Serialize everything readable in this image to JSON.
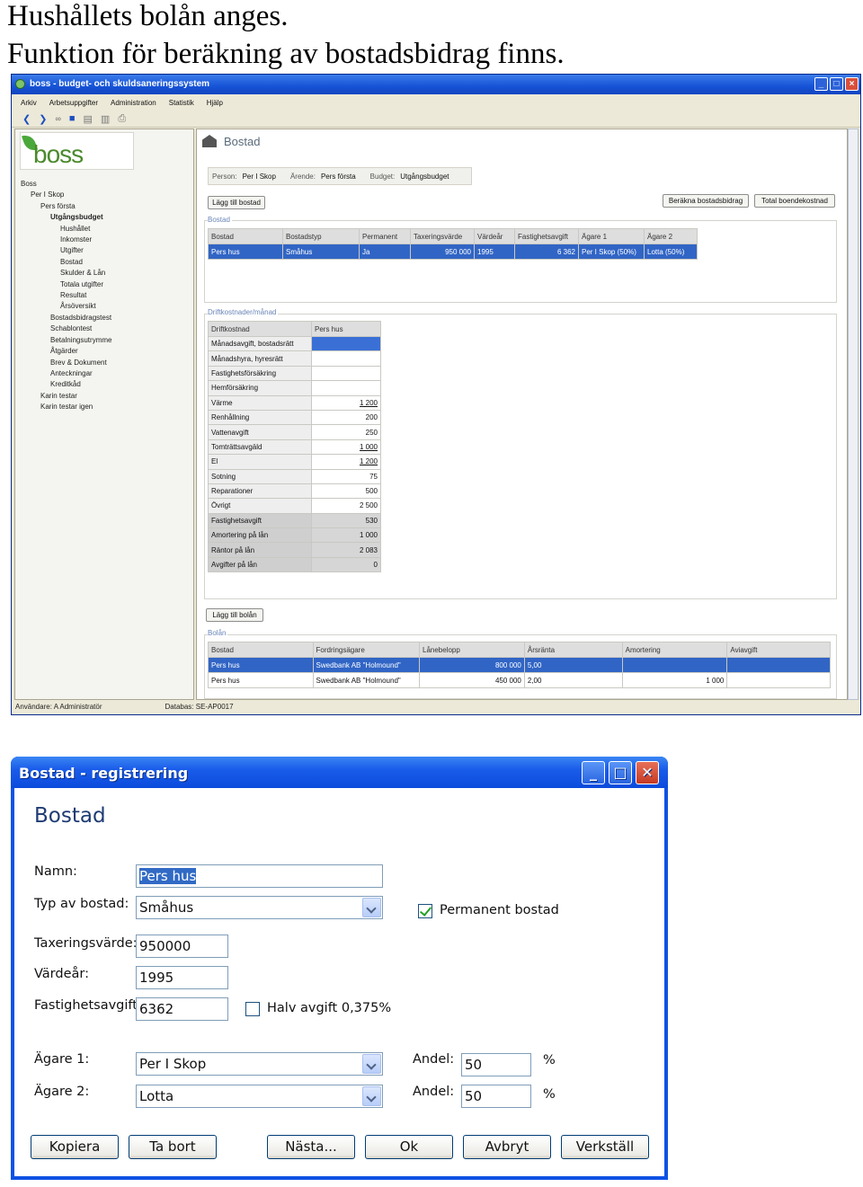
{
  "headings": [
    "Hushållets bolån anges.",
    "Funktion för beräkning av bostadsbidrag finns."
  ],
  "main_window": {
    "title": "boss - budget- och skuldsaneringssystem",
    "menu": [
      "Arkiv",
      "Arbetsuppgifter",
      "Administration",
      "Statistik",
      "Hjälp"
    ],
    "toolbar_icons": [
      "back-arrow-icon",
      "forward-arrow-icon",
      "glasses-icon",
      "save-icon",
      "print-icon",
      "copy-icon",
      "printer-icon"
    ],
    "logo_text": "boss",
    "tree": [
      {
        "label": "Boss",
        "level": 0,
        "bold": false
      },
      {
        "label": "Per I Skop",
        "level": 1,
        "bold": false
      },
      {
        "label": "Pers första",
        "level": 2,
        "bold": false
      },
      {
        "label": "Utgångsbudget",
        "level": 3,
        "bold": true
      },
      {
        "label": "Hushållet",
        "level": 4,
        "bold": false
      },
      {
        "label": "Inkomster",
        "level": 4,
        "bold": false
      },
      {
        "label": "Utgifter",
        "level": 4,
        "bold": false
      },
      {
        "label": "Bostad",
        "level": 4,
        "bold": false
      },
      {
        "label": "Skulder & Lån",
        "level": 4,
        "bold": false
      },
      {
        "label": "Totala utgifter",
        "level": 4,
        "bold": false
      },
      {
        "label": "Resultat",
        "level": 4,
        "bold": false
      },
      {
        "label": "Årsöversikt",
        "level": 4,
        "bold": false
      },
      {
        "label": "Bostadsbidragstest",
        "level": 3,
        "bold": false
      },
      {
        "label": "Schablontest",
        "level": 3,
        "bold": false
      },
      {
        "label": "Betalningsutrymme",
        "level": 3,
        "bold": false
      },
      {
        "label": "Åtgärder",
        "level": 3,
        "bold": false
      },
      {
        "label": "Brev & Dokument",
        "level": 3,
        "bold": false
      },
      {
        "label": "Anteckningar",
        "level": 3,
        "bold": false
      },
      {
        "label": "Kreditkåd",
        "level": 3,
        "bold": false
      },
      {
        "label": "Karin testar",
        "level": 2,
        "bold": false
      },
      {
        "label": "Karin testar igen",
        "level": 2,
        "bold": false
      }
    ],
    "panel_title": "Bostad",
    "info": {
      "person_label": "Person:",
      "person": "Per I Skop",
      "arende_label": "Ärende:",
      "arende": "Pers första",
      "budget_label": "Budget:",
      "budget": "Utgångsbudget"
    },
    "buttons": {
      "add_housing": "Lägg till bostad",
      "calc_bidrag": "Beräkna bostadsbidrag",
      "total_cost": "Total boendekostnad",
      "add_loan": "Lägg till bolån"
    },
    "housing": {
      "group_label": "Bostad",
      "columns": [
        "Bostad",
        "Bostadstyp",
        "Permanent",
        "Taxeringsvärde",
        "Värdeår",
        "Fastighetsavgift",
        "Ägare 1",
        "Ägare 2"
      ],
      "rows": [
        [
          "Pers hus",
          "Småhus",
          "Ja",
          "950 000",
          "1995",
          "6 362",
          "Per I Skop (50%)",
          "Lotta (50%)"
        ]
      ]
    },
    "costs": {
      "group_label": "Driftkostnader/månad",
      "col1": "Driftkostnad",
      "col2": "Pers hus",
      "rows": [
        {
          "label": "Månadsavgift, bostadsrätt",
          "value": "",
          "gray": false,
          "ul": false,
          "blue": true
        },
        {
          "label": "Månadshyra, hyresrätt",
          "value": "",
          "gray": false,
          "ul": false,
          "blue": false
        },
        {
          "label": "Fastighetsförsäkring",
          "value": "",
          "gray": false,
          "ul": false,
          "blue": false
        },
        {
          "label": "Hemförsäkring",
          "value": "",
          "gray": false,
          "ul": false,
          "blue": false
        },
        {
          "label": "Värme",
          "value": "1 200",
          "gray": false,
          "ul": true,
          "blue": false
        },
        {
          "label": "Renhållning",
          "value": "200",
          "gray": false,
          "ul": false,
          "blue": false
        },
        {
          "label": "Vattenavgift",
          "value": "250",
          "gray": false,
          "ul": false,
          "blue": false
        },
        {
          "label": "Tomträttsavgäld",
          "value": "1 000",
          "gray": false,
          "ul": true,
          "blue": false
        },
        {
          "label": "El",
          "value": "1 200",
          "gray": false,
          "ul": true,
          "blue": false
        },
        {
          "label": "Sotning",
          "value": "75",
          "gray": false,
          "ul": false,
          "blue": false
        },
        {
          "label": "Reparationer",
          "value": "500",
          "gray": false,
          "ul": false,
          "blue": false
        },
        {
          "label": "Övrigt",
          "value": "2 500",
          "gray": false,
          "ul": false,
          "blue": false
        },
        {
          "label": "Fastighetsavgift",
          "value": "530",
          "gray": true,
          "ul": false,
          "blue": false
        },
        {
          "label": "Amortering på lån",
          "value": "1 000",
          "gray": true,
          "ul": false,
          "blue": false
        },
        {
          "label": "Räntor på lån",
          "value": "2 083",
          "gray": true,
          "ul": false,
          "blue": false
        },
        {
          "label": "Avgifter på lån",
          "value": "0",
          "gray": true,
          "ul": false,
          "blue": false
        }
      ]
    },
    "loans": {
      "group_label": "Bolån",
      "columns": [
        "Bostad",
        "Fordringsägare",
        "Lånebelopp",
        "Årsränta",
        "Amortering",
        "Aviavgift"
      ],
      "rows": [
        [
          "Pers hus",
          "Swedbank AB \"Holmound\"",
          "800 000",
          "5,00",
          "",
          ""
        ],
        [
          "Pers hus",
          "Swedbank AB \"Holmound\"",
          "450 000",
          "2,00",
          "1 000",
          ""
        ]
      ]
    },
    "status": {
      "user": "Användare: A Administratör",
      "db": "Databas: SE-AP0017"
    }
  },
  "dialog": {
    "title": "Bostad - registrering",
    "header": "Bostad",
    "name_label": "Namn:",
    "name_value": "Pers hus",
    "type_label": "Typ av bostad:",
    "type_value": "Småhus",
    "permanent_label": "Permanent bostad",
    "permanent_checked": true,
    "tax_label": "Taxeringsvärde:",
    "tax_value": "950000",
    "year_label": "Värdeår:",
    "year_value": "1995",
    "fee_label": "Fastighetsavgift:",
    "fee_value": "6362",
    "half_fee_label": "Halv avgift 0,375%",
    "half_fee_checked": false,
    "owner1_label": "Ägare 1:",
    "owner1_value": "Per I Skop",
    "owner2_label": "Ägare 2:",
    "owner2_value": "Lotta",
    "share_label": "Andel:",
    "share1": "50",
    "share2": "50",
    "percent": "%",
    "buttons": [
      "Kopiera",
      "Ta bort",
      "Nästa...",
      "Ok",
      "Avbryt",
      "Verkställ"
    ]
  }
}
